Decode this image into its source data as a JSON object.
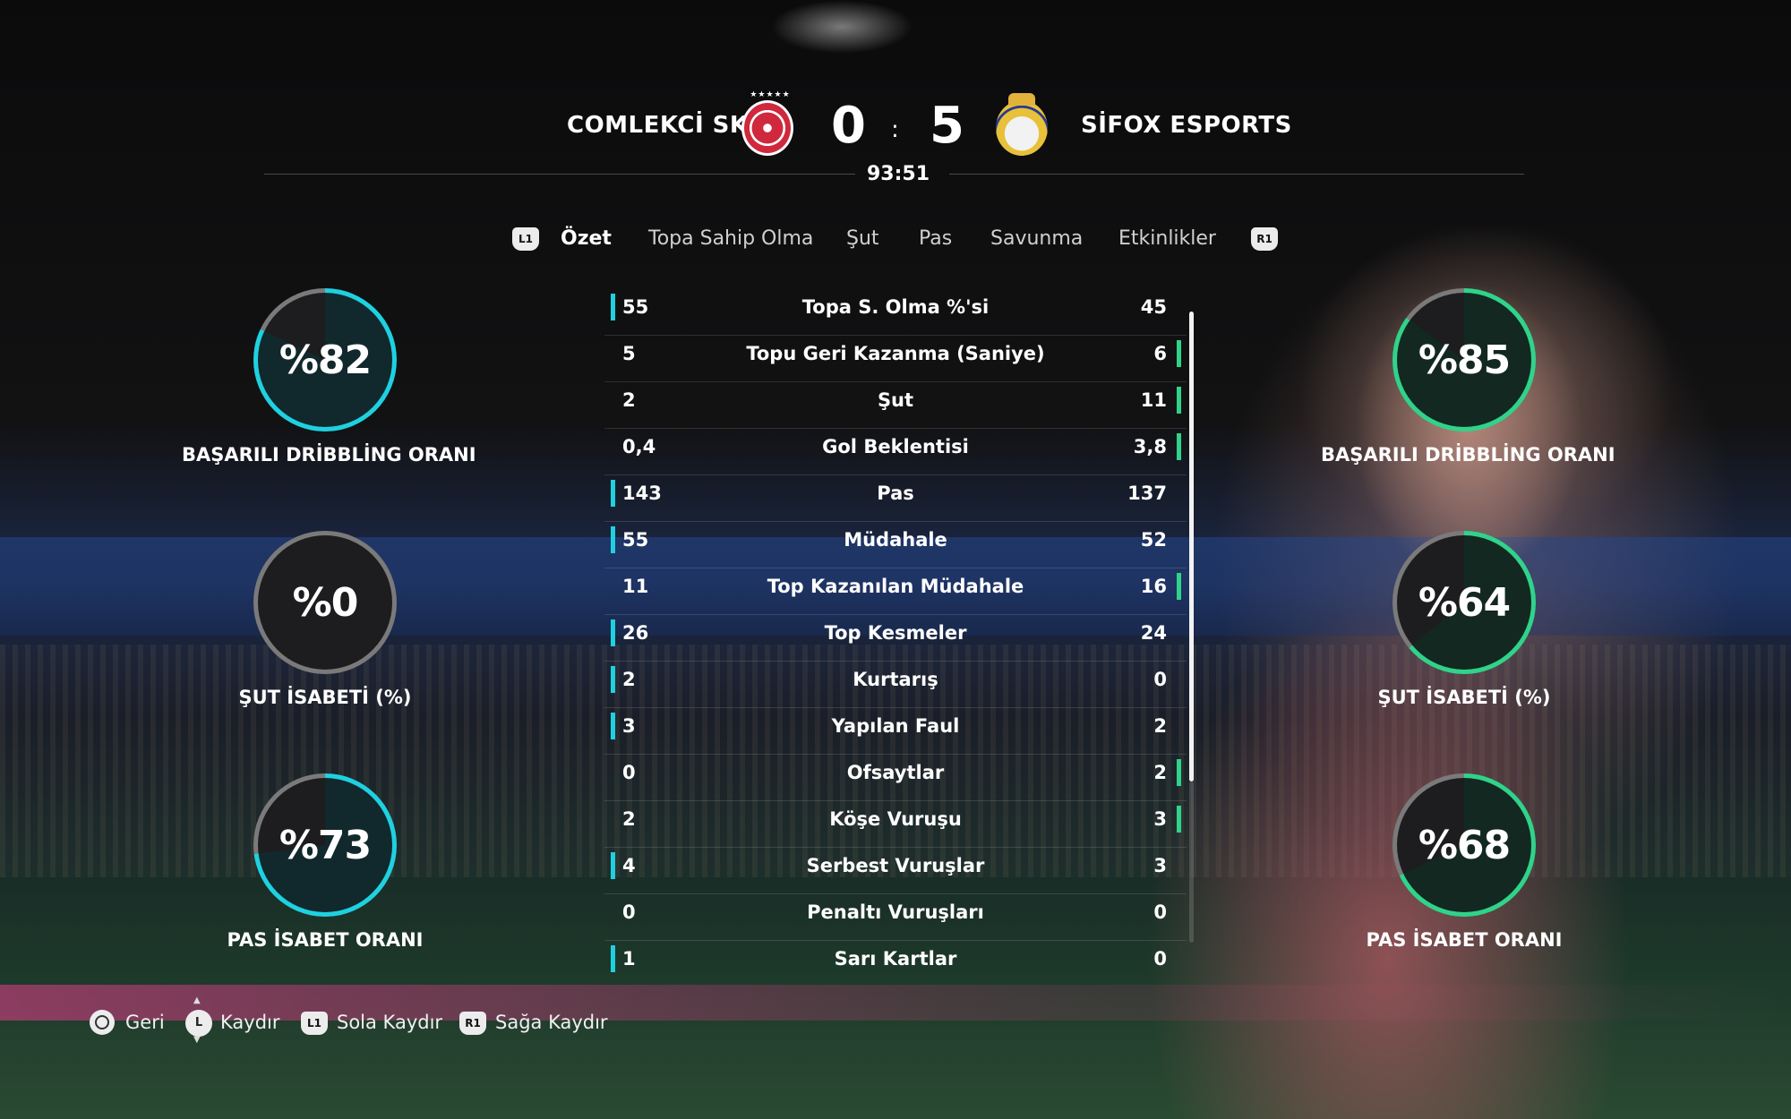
{
  "match": {
    "home_team": "COMLEKCİ SK",
    "away_team": "SİFOX ESPORTS",
    "home_score": "0",
    "away_score": "5",
    "separator": ":",
    "clock": "93:51"
  },
  "tabs": {
    "left_button": "L1",
    "right_button": "R1",
    "items": [
      "Özet",
      "Topa Sahip Olma",
      "Şut",
      "Pas",
      "Savunma",
      "Etkinlikler"
    ],
    "active": "Özet"
  },
  "home_rings": [
    {
      "value": "%82",
      "label": "BAŞARILI DRİBBLİNG ORANI",
      "percent": 82
    },
    {
      "value": "%0",
      "label": "ŞUT İSABETİ (%)",
      "percent": 0
    },
    {
      "value": "%73",
      "label": "PAS İSABET ORANI",
      "percent": 73
    }
  ],
  "away_rings": [
    {
      "value": "%85",
      "label": "BAŞARILI DRİBBLİNG ORANI",
      "percent": 85
    },
    {
      "value": "%64",
      "label": "ŞUT İSABETİ (%)",
      "percent": 64
    },
    {
      "value": "%68",
      "label": "PAS İSABET ORANI",
      "percent": 68
    }
  ],
  "stats": [
    {
      "home": "55",
      "label": "Topa S. Olma %'si",
      "away": "45",
      "leader": "home"
    },
    {
      "home": "5",
      "label": "Topu Geri Kazanma (Saniye)",
      "away": "6",
      "leader": "away"
    },
    {
      "home": "2",
      "label": "Şut",
      "away": "11",
      "leader": "away"
    },
    {
      "home": "0,4",
      "label": "Gol Beklentisi",
      "away": "3,8",
      "leader": "away"
    },
    {
      "home": "143",
      "label": "Pas",
      "away": "137",
      "leader": "home"
    },
    {
      "home": "55",
      "label": "Müdahale",
      "away": "52",
      "leader": "home"
    },
    {
      "home": "11",
      "label": "Top Kazanılan Müdahale",
      "away": "16",
      "leader": "away"
    },
    {
      "home": "26",
      "label": "Top Kesmeler",
      "away": "24",
      "leader": "home"
    },
    {
      "home": "2",
      "label": "Kurtarış",
      "away": "0",
      "leader": "home"
    },
    {
      "home": "3",
      "label": "Yapılan Faul",
      "away": "2",
      "leader": "home"
    },
    {
      "home": "0",
      "label": "Ofsaytlar",
      "away": "2",
      "leader": "away"
    },
    {
      "home": "2",
      "label": "Köşe Vuruşu",
      "away": "3",
      "leader": "away"
    },
    {
      "home": "4",
      "label": "Serbest Vuruşlar",
      "away": "3",
      "leader": "home"
    },
    {
      "home": "0",
      "label": "Penaltı Vuruşları",
      "away": "0",
      "leader": "none"
    },
    {
      "home": "1",
      "label": "Sarı Kartlar",
      "away": "0",
      "leader": "home"
    }
  ],
  "footer": {
    "back": "Geri",
    "scroll": "Kaydır",
    "scroll_button": "L",
    "scroll_left": "Sola Kaydır",
    "scroll_left_button": "L1",
    "scroll_right": "Sağa Kaydır",
    "scroll_right_button": "R1"
  },
  "colors": {
    "home_accent": "#1fd1e0",
    "away_accent": "#2fd38a",
    "ring_track": "#7a7a7a"
  }
}
